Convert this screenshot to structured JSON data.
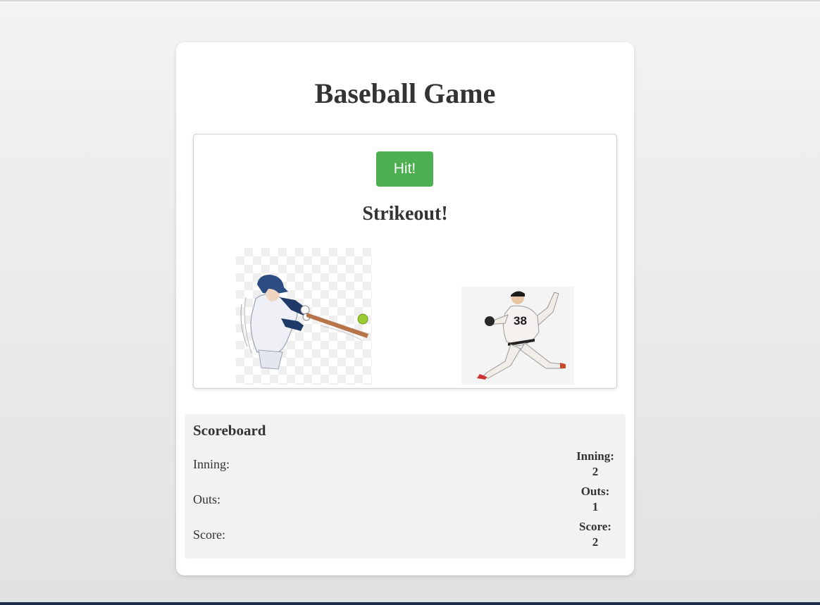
{
  "game": {
    "title": "Baseball Game",
    "hit_button_label": "Hit!",
    "result_text": "Strikeout!",
    "accent_color": "#4caf50"
  },
  "scoreboard": {
    "title": "Scoreboard",
    "rows": [
      {
        "label": "Inning:",
        "value_label": "Inning:",
        "value": "2"
      },
      {
        "label": "Outs:",
        "value_label": "Outs:",
        "value": "1"
      },
      {
        "label": "Score:",
        "value_label": "Score:",
        "value": "2"
      }
    ]
  },
  "images": {
    "batter": "batter-image",
    "pitcher": "pitcher-image",
    "pitcher_jersey_number": "38"
  }
}
